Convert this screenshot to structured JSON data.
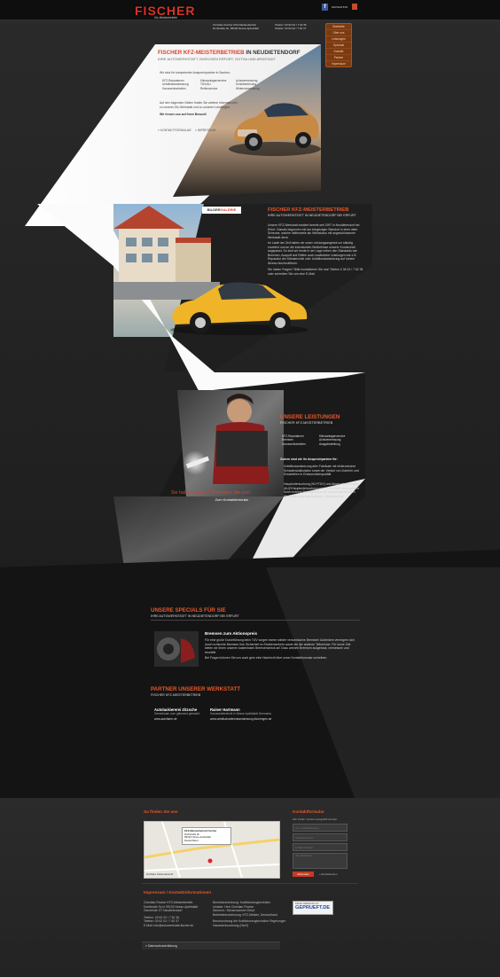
{
  "header": {
    "logo_text": "FISCHER",
    "logo_sub": "Kfz-Meisterbetrieb",
    "company_name": "Christian Fischer KFZ-Meisterbetrieb",
    "company_street": "Dorfstraße 9c, 99192 Nesse-Apfelstädt",
    "phone": "Telefon: 03 62 02 / 7 62 36",
    "fax": "Telefax: 03 62 02 / 7 62 37",
    "nav_label": "NAVIGATION",
    "nav_items": [
      "Startseite",
      "Über uns",
      "Leistungen",
      "Specials",
      "Kontakt",
      "Partner",
      "Impressum"
    ]
  },
  "section1": {
    "title_a": "FISCHER KFZ-MEISTERBETRIEB",
    "title_b": " IN NEUDIETENDORF",
    "subtitle": "IHRE AUTOWERKSTATT ZWISCHEN ERFURT, GOTHA UND ARNSTADT",
    "intro": "Wir sind Ihr kompetenter Ansprechpartner in Sachen:",
    "services_col1": [
      "KFZ-Reparaturen",
      "Unfallinstandsetzung",
      "Karosseriearbeiten"
    ],
    "services_col2": [
      "Klimaanlagenservice",
      "TÜV/AU",
      "Reifenservice"
    ],
    "services_col3": [
      "Achsvermessung",
      "Scheibentönung",
      "Wintervermessung"
    ],
    "text": "Auf den folgenden Seiten finden Sie weitere Informationen zu unserer Kfz-Werkstatt und zu unseren Leistungen.",
    "closing": "Wir freuen uns auf Ihren Besuch!",
    "link1": "» KONTAKTFORMULAR",
    "link2": "» IMPRESSUM"
  },
  "section2": {
    "gallery_a": "BILDER",
    "gallery_b": "GALERIE",
    "title": "FISCHER KFZ-MEISTERBETRIEB",
    "subtitle": "IHRE AUTOWERKSTATT IN NEUDIETENDORF BEI ERFURT",
    "para1": "Unsere KFZ-Werkstatt existiert bereits seit 1997 in Neudietendorf bei Erfurt. Damals begonnen mit am ehrgeizigen Standort in einer alten Scheune, welche mittlerweile als Werkshaus mit angeschlossener Werkstatt dient.",
    "para2": "Im Laufe der Zeit haben wir unser Leistungsangebot um ständig erweitert und an die individuellen Bedürfnisse unserer Kundschaft angepasst. So sind wir heute in der Lage neben den Standards wie Bremsen, Auspuff und Reifen auch zusätzliche Leistungen wie z.B. Reparatur der Klimatechnik oder Unfallinstandsetzung auf hohem Niveau durchzuführen.",
    "para3": "Sie haben Fragen? Bitte kontaktieren Sie uns! Telefon 0 36 02 / 7 62 36 oder schreiben Sie uns eine E-Mail."
  },
  "section3": {
    "title": "UNSERE LEISTUNGEN",
    "subtitle": "FISCHER KFZ-MEISTERBETRIEB",
    "col1": [
      "KFZ-Reparaturen",
      "Bremsen",
      "Karosseriearbeiten"
    ],
    "col2": [
      "Klimaanlagenservice",
      "Achsvermessung",
      "Ausgabestellung"
    ],
    "extra_title": "Zudem sind wir Ihr Ansprechpartner für:",
    "extra1": "Unfallinstandsetzung aller Fabrikate mit elektronischer Schadenskalkulation sowie der Verlauf von Zubehör und Ersatzteilen in Erstausrüsterqualität",
    "extra2": "Hauptuntersuchung (HU*/TÜV) und Abgasuntersuchung (AU)*/Hauptuntersuchung nach §29 StVZO durchgeführt durch externe Prüfingenieure der amtlich anerkannten Überwachungsorganisationen | Reifenservice",
    "cta_title": "Sie haben Fragen? Schreiben Sie uns!",
    "cta_link": "Zum Kontaktformular"
  },
  "section4": {
    "title": "UNSERE SPECIALS FÜR SIE",
    "subtitle": "IHRE AUTOWERKSTATT IN NEUDIETENDORF BEI ERFURT",
    "offer_title": "Bremsen zum Aktionspreis",
    "offer_text": "Für eine große Durchführung beim TÜV sorgen immer wieder verschlissene Bremsen! Außerdem verringern sich durch schlechte Bremsen Ihre Sicherheit im Straßenverkehr sowie die der anderen Teilnehmer. Für kurze Zeit bieten wir Ihnen unseren kostenlosen Bremsencheck an! Dazu werden Bremsen ausgebaut, vermessen und beurteilt.",
    "offer_note": "Bei Fragen können Sie uns auch gern eine Nachricht über unser Kontaktformular schreiben."
  },
  "section5": {
    "title": "PARTNER UNSERER WERKSTATT",
    "subtitle": "FISCHER KFZ-MEISTERBETRIEB",
    "partners": [
      {
        "name": "Autolackiererei Zitzsche",
        "desc": "Gemeinsam zum glänzend gemacht",
        "url": "www.autofarbe.de"
      },
      {
        "name": "Rainer Hartmann",
        "desc": "Karosserietechnik in Nesse-Apfelstädt Germania",
        "url": "www.unfallschadeninstandsetzung-thueringen.de"
      }
    ]
  },
  "footer": {
    "map_title": "So finden Sie uns",
    "map_card_title": "KFZ-Meisterbetrieb Fischer",
    "map_card_lines": [
      "Dorfstraße 9c",
      "99192 Nesse-Apfelstädt",
      "Deutschland"
    ],
    "map_large": "Größere Kartenansicht",
    "contact_title": "Kontaktformular",
    "contact_note": "Alle Felder müssen ausgefüllt werden.",
    "field_name": "Vor- und Nachname",
    "field_phone": "Telefonnummer",
    "field_email": "E-Mail Adresse",
    "field_message": "Ihre Nachricht",
    "send_label": "Absenden",
    "reset_label": "» Zurücksetzen",
    "impressum_title": "Impressum / Kontaktinformationen",
    "imp_left": [
      "Christian Fischer KFZ-Meisterbetrieb",
      "Dorfstraße 9c in 99192 Nesse-Apfelstädt",
      "Gemeinde OT Neudietendorf",
      "",
      "Telefon: 03 62 02 / 7 62 36",
      "Telefax: 03 62 02 / 7 62 37",
      "E-Mail: info@autowerkstatt-fischer.de"
    ],
    "imp_right": [
      "Berufsbezeichnung: Kraftfahrzeugtechniker",
      "Inhaber: Herr Christian Fischer",
      "Steuernr.: Steuernummer Erfurt",
      "Betriebsbezeichnung: KFZ-Meister, Deutschland",
      "",
      "Berufsordnung der Kraftfahrzeugtechniker Regelungen",
      "Handwerksordnung (HwO)"
    ],
    "badge_small": "DIESE WEBSEITE IST",
    "badge_big": "GEPRUEFT.DE",
    "privacy": "» Datenschutzerklärung"
  }
}
